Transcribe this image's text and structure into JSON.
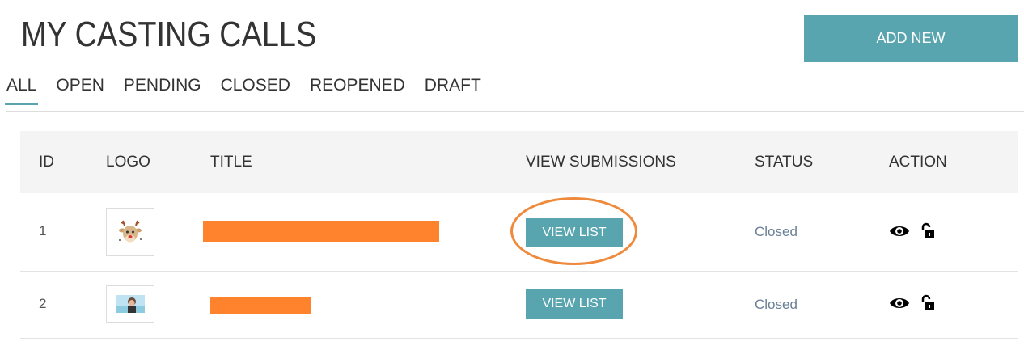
{
  "header": {
    "title": "MY CASTING CALLS",
    "add_new_label": "ADD NEW"
  },
  "tabs": [
    {
      "label": "ALL",
      "active": true
    },
    {
      "label": "OPEN",
      "active": false
    },
    {
      "label": "PENDING",
      "active": false
    },
    {
      "label": "CLOSED",
      "active": false
    },
    {
      "label": "REOPENED",
      "active": false
    },
    {
      "label": "DRAFT",
      "active": false
    }
  ],
  "table": {
    "headers": [
      "ID",
      "LOGO",
      "TITLE",
      "VIEW SUBMISSIONS",
      "STATUS",
      "ACTION"
    ],
    "rows": [
      {
        "id": "1",
        "view_label": "VIEW LIST",
        "status": "Closed",
        "title_redacted": true,
        "logo": "reindeer-logo"
      },
      {
        "id": "2",
        "view_label": "VIEW LIST",
        "status": "Closed",
        "title_redacted": true,
        "logo": "photo-logo"
      }
    ]
  },
  "colors": {
    "accent": "#58a5b0",
    "redaction": "#ff832d",
    "highlight": "#ef8a3c",
    "status": "#6a7f96"
  }
}
